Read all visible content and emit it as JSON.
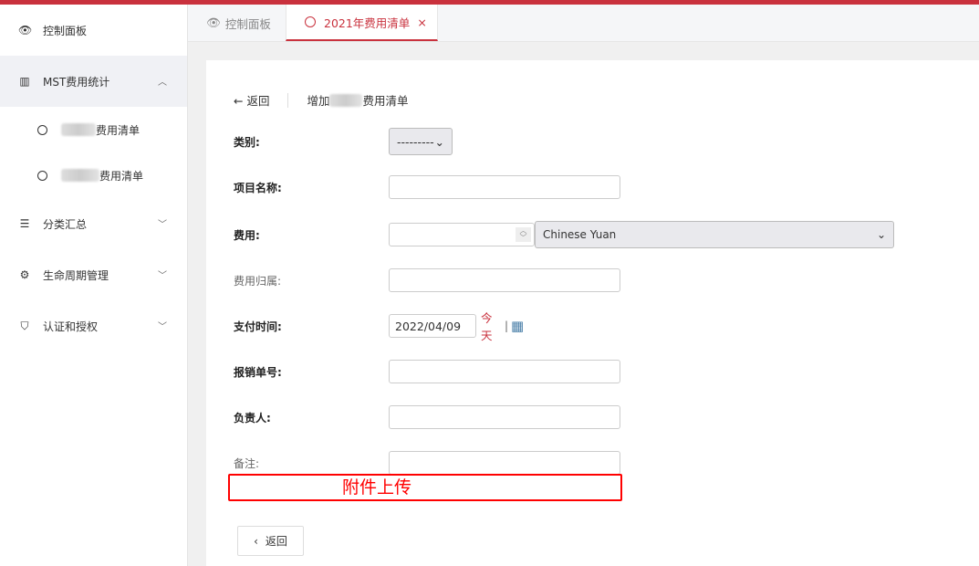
{
  "colors": {
    "accent": "#c9313d"
  },
  "sidebar": {
    "items": [
      {
        "label": "控制面板",
        "icon": "eye-icon"
      },
      {
        "label": "MST费用统计",
        "icon": "bar-chart-icon",
        "expanded": true,
        "children": [
          {
            "label": "费用清单"
          },
          {
            "label": "费用清单"
          }
        ]
      },
      {
        "label": "分类汇总",
        "icon": "list-icon"
      },
      {
        "label": "生命周期管理",
        "icon": "gear-icon"
      },
      {
        "label": "认证和授权",
        "icon": "shield-icon"
      }
    ]
  },
  "tabs": [
    {
      "label": "控制面板",
      "icon": "eye-icon"
    },
    {
      "label": "2021年费用清单",
      "icon": "circle-icon",
      "active": true
    }
  ],
  "header": {
    "back": "返回",
    "title_prefix": "增加",
    "title_suffix": "费用清单"
  },
  "form": {
    "category": {
      "label": "类别:",
      "value": "---------"
    },
    "name": {
      "label": "项目名称:",
      "value": ""
    },
    "cost": {
      "label": "费用:",
      "value": "",
      "currency": "Chinese Yuan"
    },
    "owner": {
      "label": "费用归属:",
      "value": ""
    },
    "pay_date": {
      "label": "支付时间:",
      "value": "2022/04/09",
      "today": "今天",
      "sep": "|"
    },
    "reimb": {
      "label": "报销单号:",
      "value": ""
    },
    "person": {
      "label": "负责人:",
      "value": ""
    },
    "note": {
      "label": "备注:",
      "value": ""
    }
  },
  "annotation": "附件上传",
  "back_button": "返回"
}
